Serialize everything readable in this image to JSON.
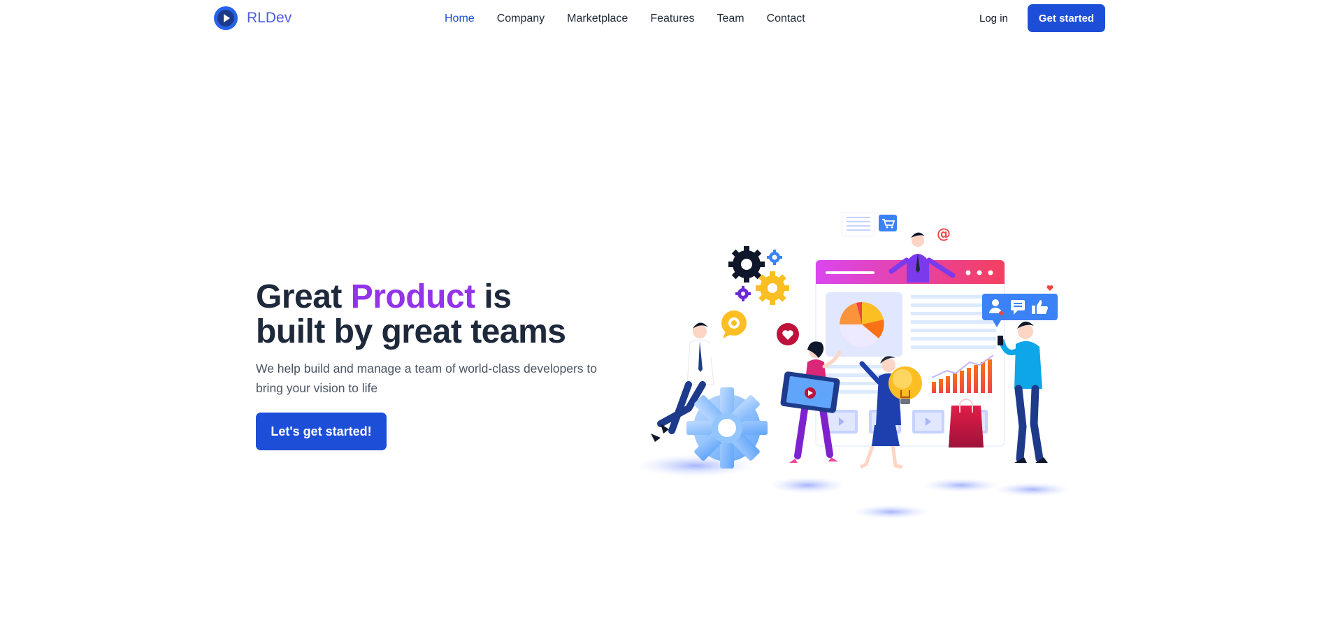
{
  "brand": {
    "name": "RLDev",
    "logo_icon": "play-circle-icon",
    "color": "#4b5ce4"
  },
  "nav": {
    "items": [
      {
        "label": "Home",
        "active": true
      },
      {
        "label": "Company",
        "active": false
      },
      {
        "label": "Marketplace",
        "active": false
      },
      {
        "label": "Features",
        "active": false
      },
      {
        "label": "Team",
        "active": false
      },
      {
        "label": "Contact",
        "active": false
      }
    ],
    "active_color": "#1d4ed8"
  },
  "header": {
    "login_label": "Log in",
    "cta_label": "Get started"
  },
  "hero": {
    "title_part1": "Great ",
    "title_accent": "Product",
    "title_part2": " is",
    "title_line2": "built by great teams",
    "subtitle": "We help build and manage a team of world-class developers to bring your vision to life",
    "button_label": "Let's get started!",
    "accent_color": "#9333ea",
    "primary_color": "#1d4ed8"
  },
  "illustration": {
    "icons": [
      "gear-icon",
      "shopping-cart-icon",
      "at-sign-icon",
      "heart-icon",
      "pie-chart-icon",
      "bar-chart-icon",
      "lightbulb-icon",
      "shopping-bag-icon",
      "user-icon",
      "chat-icon",
      "thumbs-up-icon",
      "video-play-icon"
    ]
  }
}
